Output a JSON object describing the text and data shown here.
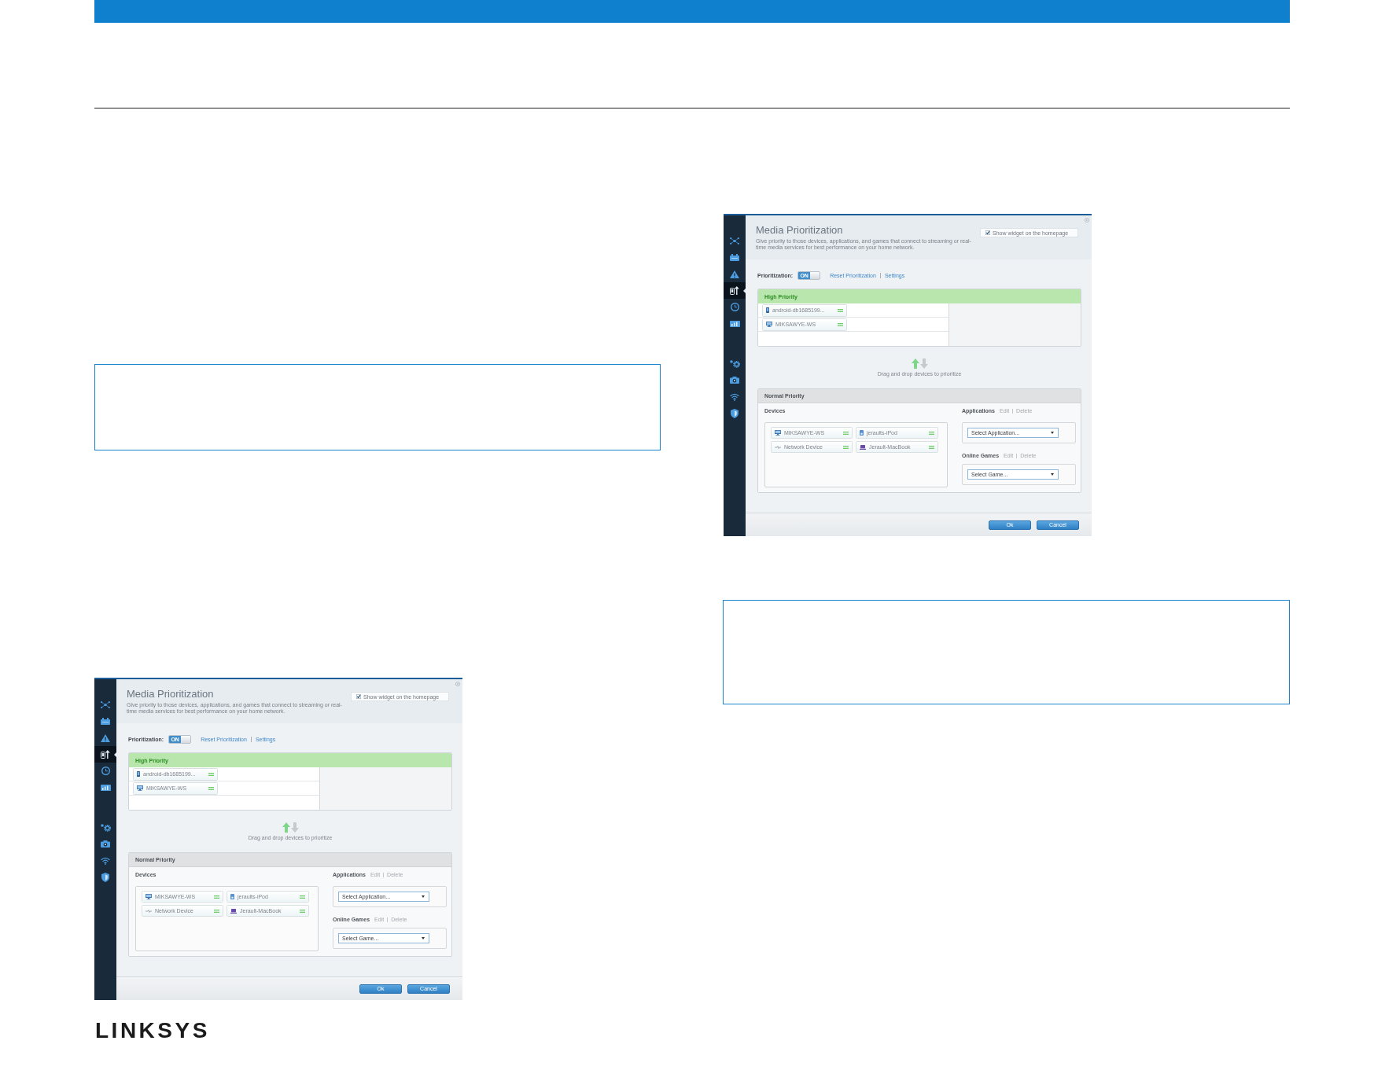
{
  "screenshots": [
    {
      "sidebar": [
        {
          "selected": false
        },
        {
          "selected": false
        },
        {
          "selected": false
        },
        {
          "selected": true
        },
        {
          "selected": false
        },
        {
          "selected": false
        },
        {
          "selected": false
        },
        {
          "selected": false
        },
        {
          "selected": false
        },
        {
          "selected": false
        }
      ],
      "title": "Media Prioritization",
      "description": "Give priority to those devices, applications, and games that connect to streaming or real-time media services for best performance on your home network.",
      "show_widget": {
        "label": "Show widget on the homepage",
        "checked": true
      },
      "prioritization": {
        "label": "Prioritization:",
        "toggle": {
          "label": "ON",
          "on": true
        },
        "links": [
          "Reset Prioritization",
          "Settings"
        ]
      },
      "high_priority": {
        "title": "High Priority",
        "devices": [
          {
            "name": "android-db1685199...",
            "kind": "phone"
          },
          {
            "name": "MIKSAWYE-WS",
            "kind": "computer"
          }
        ]
      },
      "hint": "Drag and drop devices to prioritize",
      "normal_priority": {
        "title": "Normal Priority",
        "devices_label": "Devices",
        "devices": [
          {
            "name": "MIKSAWYE-WS",
            "kind": "computer"
          },
          {
            "name": "jeraults-iPod",
            "kind": "player"
          },
          {
            "name": "Network Device",
            "kind": "network"
          },
          {
            "name": "Jerault-MacBook",
            "kind": "laptop"
          }
        ],
        "applications": {
          "label": "Applications",
          "actions": [
            "Edit",
            "Delete"
          ],
          "dropdown": "Select Application..."
        },
        "online_games": {
          "label": "Online Games",
          "actions": [
            "Edit",
            "Delete"
          ],
          "dropdown": "Select Game..."
        }
      },
      "buttons": [
        "Ok",
        "Cancel"
      ]
    },
    {
      "sidebar": [
        {
          "selected": false
        },
        {
          "selected": false
        },
        {
          "selected": false
        },
        {
          "selected": true
        },
        {
          "selected": false
        },
        {
          "selected": false
        },
        {
          "selected": false
        },
        {
          "selected": false
        },
        {
          "selected": false
        },
        {
          "selected": false
        }
      ],
      "title": "Media Prioritization",
      "description": "Give priority to those devices, applications, and games that connect to streaming or real-time media services for best performance on your home network.",
      "show_widget": {
        "label": "Show widget on the homepage",
        "checked": true
      },
      "prioritization": {
        "label": "Prioritization:",
        "toggle": {
          "label": "ON",
          "on": true
        },
        "links": [
          "Reset Prioritization",
          "Settings"
        ]
      },
      "high_priority": {
        "title": "High Priority",
        "devices": [
          {
            "name": "android-db1685199...",
            "kind": "phone"
          },
          {
            "name": "MIKSAWYE-WS",
            "kind": "computer"
          }
        ]
      },
      "hint": "Drag and drop devices to prioritize",
      "normal_priority": {
        "title": "Normal Priority",
        "devices_label": "Devices",
        "devices": [
          {
            "name": "MIKSAWYE-WS",
            "kind": "computer"
          },
          {
            "name": "jeraults-iPod",
            "kind": "player"
          },
          {
            "name": "Network Device",
            "kind": "network"
          },
          {
            "name": "Jerault-MacBook",
            "kind": "laptop"
          }
        ],
        "applications": {
          "label": "Applications",
          "actions": [
            "Edit",
            "Delete"
          ],
          "dropdown": "Select Application..."
        },
        "online_games": {
          "label": "Online Games",
          "actions": [
            "Edit",
            "Delete"
          ],
          "dropdown": "Select Game..."
        }
      },
      "buttons": [
        "Ok",
        "Cancel"
      ]
    }
  ],
  "footer": {
    "logo": "LINKSYS"
  }
}
